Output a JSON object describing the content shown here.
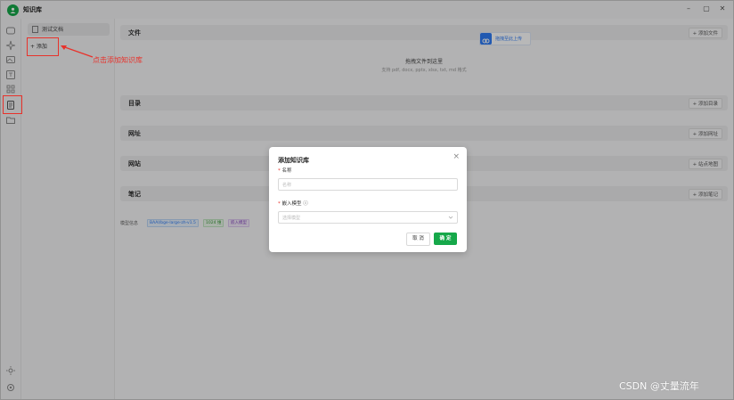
{
  "app": {
    "title": "知识库"
  },
  "window": {
    "min": "–",
    "max": "▢",
    "close": "✕"
  },
  "sidebar": {
    "kb_items": [
      {
        "label": "测试文档"
      }
    ],
    "add_label": "+ 添加"
  },
  "annotation": {
    "text": "点击添加知识库"
  },
  "sections": {
    "files": {
      "label": "文件",
      "button": "+ 添加文件"
    },
    "dropzone": {
      "title": "拖拽文件到这里",
      "subtitle": "支持 pdf, docx, pptx, xlsx, txt, md 格式"
    },
    "badge": {
      "label": "拖拽至此上传"
    },
    "directory": {
      "label": "目录",
      "button": "+ 添加目录"
    },
    "url": {
      "label": "网址",
      "button": "+ 添加网址"
    },
    "website": {
      "label": "网站",
      "button": "+ 站点地图"
    },
    "notes": {
      "label": "笔记",
      "button": "+ 添加笔记"
    }
  },
  "model_info": {
    "label": "模型信息",
    "tags": [
      "BAAI/bge-large-zh-v1.5",
      "1024 维",
      "嵌入模型"
    ]
  },
  "dialog": {
    "title": "添加知识库",
    "name_label": "名称",
    "name_placeholder": "名称",
    "model_label": "嵌入模型",
    "model_placeholder": "选择模型",
    "cancel": "取 消",
    "ok": "确 定"
  },
  "watermark": "CSDN @丈量流年",
  "colors": {
    "accent": "#16a84a",
    "annotation": "#e8322b",
    "link": "#2f7cf6"
  }
}
